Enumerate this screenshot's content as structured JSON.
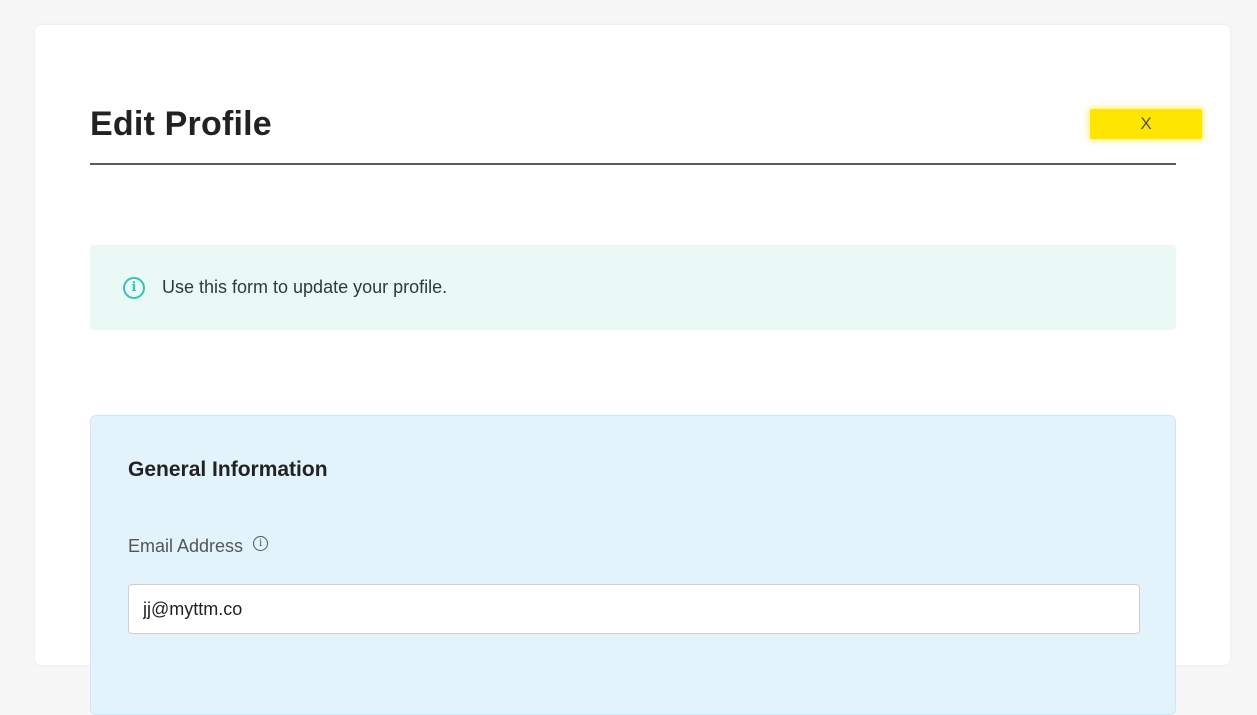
{
  "modal": {
    "title": "Edit Profile",
    "close_label": "X",
    "close_highlight_color": "#ffe500"
  },
  "info_banner": {
    "icon": "info-circle-icon",
    "text": "Use this form to update your profile."
  },
  "general_section": {
    "title": "General Information",
    "email": {
      "label": "Email Address",
      "info_icon": "info-circle-icon",
      "value": "jj@myttm.co"
    }
  }
}
